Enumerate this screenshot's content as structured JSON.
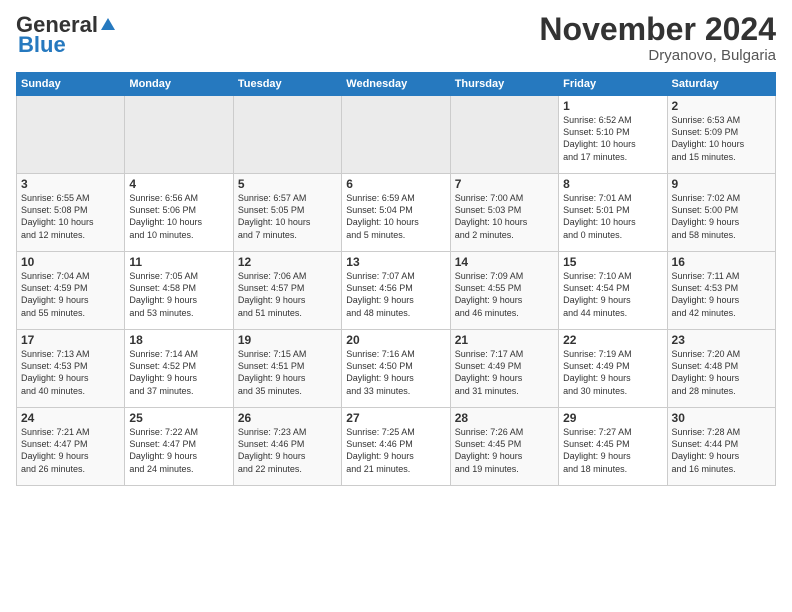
{
  "header": {
    "logo_general": "General",
    "logo_blue": "Blue",
    "month_year": "November 2024",
    "location": "Dryanovo, Bulgaria"
  },
  "days_of_week": [
    "Sunday",
    "Monday",
    "Tuesday",
    "Wednesday",
    "Thursday",
    "Friday",
    "Saturday"
  ],
  "weeks": [
    [
      {
        "num": "",
        "info": ""
      },
      {
        "num": "",
        "info": ""
      },
      {
        "num": "",
        "info": ""
      },
      {
        "num": "",
        "info": ""
      },
      {
        "num": "",
        "info": ""
      },
      {
        "num": "1",
        "info": "Sunrise: 6:52 AM\nSunset: 5:10 PM\nDaylight: 10 hours\nand 17 minutes."
      },
      {
        "num": "2",
        "info": "Sunrise: 6:53 AM\nSunset: 5:09 PM\nDaylight: 10 hours\nand 15 minutes."
      }
    ],
    [
      {
        "num": "3",
        "info": "Sunrise: 6:55 AM\nSunset: 5:08 PM\nDaylight: 10 hours\nand 12 minutes."
      },
      {
        "num": "4",
        "info": "Sunrise: 6:56 AM\nSunset: 5:06 PM\nDaylight: 10 hours\nand 10 minutes."
      },
      {
        "num": "5",
        "info": "Sunrise: 6:57 AM\nSunset: 5:05 PM\nDaylight: 10 hours\nand 7 minutes."
      },
      {
        "num": "6",
        "info": "Sunrise: 6:59 AM\nSunset: 5:04 PM\nDaylight: 10 hours\nand 5 minutes."
      },
      {
        "num": "7",
        "info": "Sunrise: 7:00 AM\nSunset: 5:03 PM\nDaylight: 10 hours\nand 2 minutes."
      },
      {
        "num": "8",
        "info": "Sunrise: 7:01 AM\nSunset: 5:01 PM\nDaylight: 10 hours\nand 0 minutes."
      },
      {
        "num": "9",
        "info": "Sunrise: 7:02 AM\nSunset: 5:00 PM\nDaylight: 9 hours\nand 58 minutes."
      }
    ],
    [
      {
        "num": "10",
        "info": "Sunrise: 7:04 AM\nSunset: 4:59 PM\nDaylight: 9 hours\nand 55 minutes."
      },
      {
        "num": "11",
        "info": "Sunrise: 7:05 AM\nSunset: 4:58 PM\nDaylight: 9 hours\nand 53 minutes."
      },
      {
        "num": "12",
        "info": "Sunrise: 7:06 AM\nSunset: 4:57 PM\nDaylight: 9 hours\nand 51 minutes."
      },
      {
        "num": "13",
        "info": "Sunrise: 7:07 AM\nSunset: 4:56 PM\nDaylight: 9 hours\nand 48 minutes."
      },
      {
        "num": "14",
        "info": "Sunrise: 7:09 AM\nSunset: 4:55 PM\nDaylight: 9 hours\nand 46 minutes."
      },
      {
        "num": "15",
        "info": "Sunrise: 7:10 AM\nSunset: 4:54 PM\nDaylight: 9 hours\nand 44 minutes."
      },
      {
        "num": "16",
        "info": "Sunrise: 7:11 AM\nSunset: 4:53 PM\nDaylight: 9 hours\nand 42 minutes."
      }
    ],
    [
      {
        "num": "17",
        "info": "Sunrise: 7:13 AM\nSunset: 4:53 PM\nDaylight: 9 hours\nand 40 minutes."
      },
      {
        "num": "18",
        "info": "Sunrise: 7:14 AM\nSunset: 4:52 PM\nDaylight: 9 hours\nand 37 minutes."
      },
      {
        "num": "19",
        "info": "Sunrise: 7:15 AM\nSunset: 4:51 PM\nDaylight: 9 hours\nand 35 minutes."
      },
      {
        "num": "20",
        "info": "Sunrise: 7:16 AM\nSunset: 4:50 PM\nDaylight: 9 hours\nand 33 minutes."
      },
      {
        "num": "21",
        "info": "Sunrise: 7:17 AM\nSunset: 4:49 PM\nDaylight: 9 hours\nand 31 minutes."
      },
      {
        "num": "22",
        "info": "Sunrise: 7:19 AM\nSunset: 4:49 PM\nDaylight: 9 hours\nand 30 minutes."
      },
      {
        "num": "23",
        "info": "Sunrise: 7:20 AM\nSunset: 4:48 PM\nDaylight: 9 hours\nand 28 minutes."
      }
    ],
    [
      {
        "num": "24",
        "info": "Sunrise: 7:21 AM\nSunset: 4:47 PM\nDaylight: 9 hours\nand 26 minutes."
      },
      {
        "num": "25",
        "info": "Sunrise: 7:22 AM\nSunset: 4:47 PM\nDaylight: 9 hours\nand 24 minutes."
      },
      {
        "num": "26",
        "info": "Sunrise: 7:23 AM\nSunset: 4:46 PM\nDaylight: 9 hours\nand 22 minutes."
      },
      {
        "num": "27",
        "info": "Sunrise: 7:25 AM\nSunset: 4:46 PM\nDaylight: 9 hours\nand 21 minutes."
      },
      {
        "num": "28",
        "info": "Sunrise: 7:26 AM\nSunset: 4:45 PM\nDaylight: 9 hours\nand 19 minutes."
      },
      {
        "num": "29",
        "info": "Sunrise: 7:27 AM\nSunset: 4:45 PM\nDaylight: 9 hours\nand 18 minutes."
      },
      {
        "num": "30",
        "info": "Sunrise: 7:28 AM\nSunset: 4:44 PM\nDaylight: 9 hours\nand 16 minutes."
      }
    ]
  ]
}
